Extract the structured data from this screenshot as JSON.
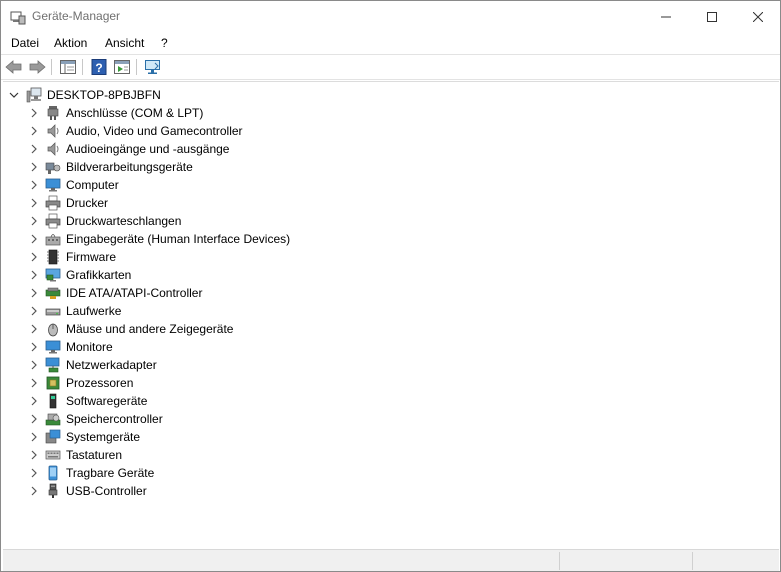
{
  "window": {
    "title": "Geräte-Manager"
  },
  "menu": [
    {
      "label": "Datei",
      "name": "menu-datei"
    },
    {
      "label": "Aktion",
      "name": "menu-aktion"
    },
    {
      "label": "Ansicht",
      "name": "menu-ansicht"
    },
    {
      "label": "?",
      "name": "menu-help"
    }
  ],
  "toolbar": [
    {
      "icon": "back-arrow-icon"
    },
    {
      "icon": "forward-arrow-icon"
    },
    {
      "icon": "show-hide-console-tree-icon"
    },
    {
      "icon": "help-icon"
    },
    {
      "icon": "properties-icon"
    },
    {
      "icon": "scan-hardware-icon"
    }
  ],
  "tree": {
    "root": "DESKTOP-8PBJBFN",
    "root_icon": "computer-icon",
    "categories": [
      {
        "label": "Anschlüsse (COM & LPT)",
        "icon": "port-icon"
      },
      {
        "label": "Audio, Video und Gamecontroller",
        "icon": "speaker-icon"
      },
      {
        "label": "Audioeingänge und -ausgänge",
        "icon": "speaker-icon"
      },
      {
        "label": "Bildverarbeitungsgeräte",
        "icon": "camera-icon"
      },
      {
        "label": "Computer",
        "icon": "monitor-icon"
      },
      {
        "label": "Drucker",
        "icon": "printer-icon"
      },
      {
        "label": "Druckwarteschlangen",
        "icon": "printer-icon"
      },
      {
        "label": "Eingabegeräte (Human Interface Devices)",
        "icon": "hid-icon"
      },
      {
        "label": "Firmware",
        "icon": "chip-icon"
      },
      {
        "label": "Grafikkarten",
        "icon": "display-adapter-icon"
      },
      {
        "label": "IDE ATA/ATAPI-Controller",
        "icon": "ide-controller-icon"
      },
      {
        "label": "Laufwerke",
        "icon": "disk-drive-icon"
      },
      {
        "label": "Mäuse und andere Zeigegeräte",
        "icon": "mouse-icon"
      },
      {
        "label": "Monitore",
        "icon": "monitor-icon"
      },
      {
        "label": "Netzwerkadapter",
        "icon": "network-adapter-icon"
      },
      {
        "label": "Prozessoren",
        "icon": "processor-icon"
      },
      {
        "label": "Softwaregeräte",
        "icon": "software-device-icon"
      },
      {
        "label": "Speichercontroller",
        "icon": "storage-controller-icon"
      },
      {
        "label": "Systemgeräte",
        "icon": "system-device-icon"
      },
      {
        "label": "Tastaturen",
        "icon": "keyboard-icon"
      },
      {
        "label": "Tragbare Geräte",
        "icon": "portable-device-icon"
      },
      {
        "label": "USB-Controller",
        "icon": "usb-icon"
      }
    ]
  }
}
